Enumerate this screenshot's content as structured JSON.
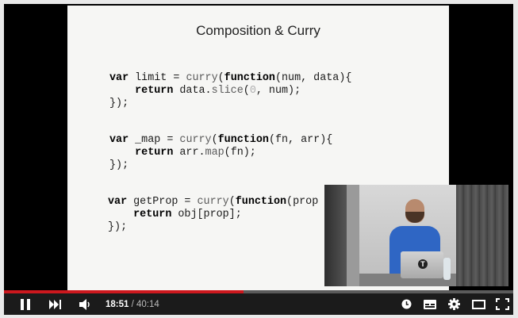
{
  "slide": {
    "title": "Composition & Curry",
    "code1": {
      "l1_kw": "var",
      "l1_a": " limit = ",
      "l1_fn": "curry",
      "l1_b": "(",
      "l1_kw2": "function",
      "l1_c": "(num, data){",
      "l2_kw": "    return",
      "l2_a": " data.",
      "l2_fn": "slice",
      "l2_b": "(",
      "l2_num": "0",
      "l2_c": ", num);",
      "l3": "});"
    },
    "code2": {
      "l1_kw": "var",
      "l1_a": " _map = ",
      "l1_fn": "curry",
      "l1_b": "(",
      "l1_kw2": "function",
      "l1_c": "(fn, arr){",
      "l2_kw": "    return",
      "l2_a": " arr.",
      "l2_fn": "map",
      "l2_c": "(fn);",
      "l3": "});"
    },
    "code3": {
      "l1_kw": "var",
      "l1_a": " getProp = ",
      "l1_fn": "curry",
      "l1_b": "(",
      "l1_kw2": "function",
      "l1_c": "(prop",
      "l2_kw": "    return",
      "l2_a": " obj[prop];",
      "l3": "});"
    }
  },
  "pip": {
    "laptop_logo": "T"
  },
  "controls": {
    "current_time": "18:51",
    "separator": " / ",
    "duration": "40:14",
    "progress": 0.47
  },
  "colors": {
    "progress": "#cc181e",
    "bar": "#1b1b1b"
  }
}
